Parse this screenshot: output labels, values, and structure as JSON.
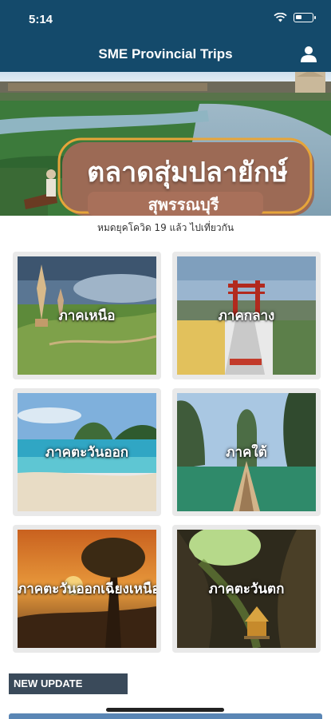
{
  "status_bar": {
    "time": "5:14",
    "wifi_icon": "wifi-icon",
    "battery_icon": "battery-icon"
  },
  "nav": {
    "title": "SME Provincial Trips",
    "profile_icon": "person-icon"
  },
  "banner": {
    "title": "ตลาดสุ่มปลายักษ์",
    "subtitle_line": "สุพรรณบุรี"
  },
  "subtitle": "หมดยุคโควิด 19 แล้ว ไปเที่ยวกัน",
  "regions": [
    {
      "label": "ภาคเหนือ"
    },
    {
      "label": "ภาคกลาง"
    },
    {
      "label": "ภาคตะวันออก"
    },
    {
      "label": "ภาคใต้"
    },
    {
      "label": "ภาคตะวันออกเฉียงเหนือ"
    },
    {
      "label": "ภาคตะวันตก"
    }
  ],
  "section": {
    "new_update": "NEW UPDATE"
  },
  "colors": {
    "header": "#144a6b",
    "card_bg": "#e9e9e9",
    "section_label": "#3a4a5a"
  }
}
